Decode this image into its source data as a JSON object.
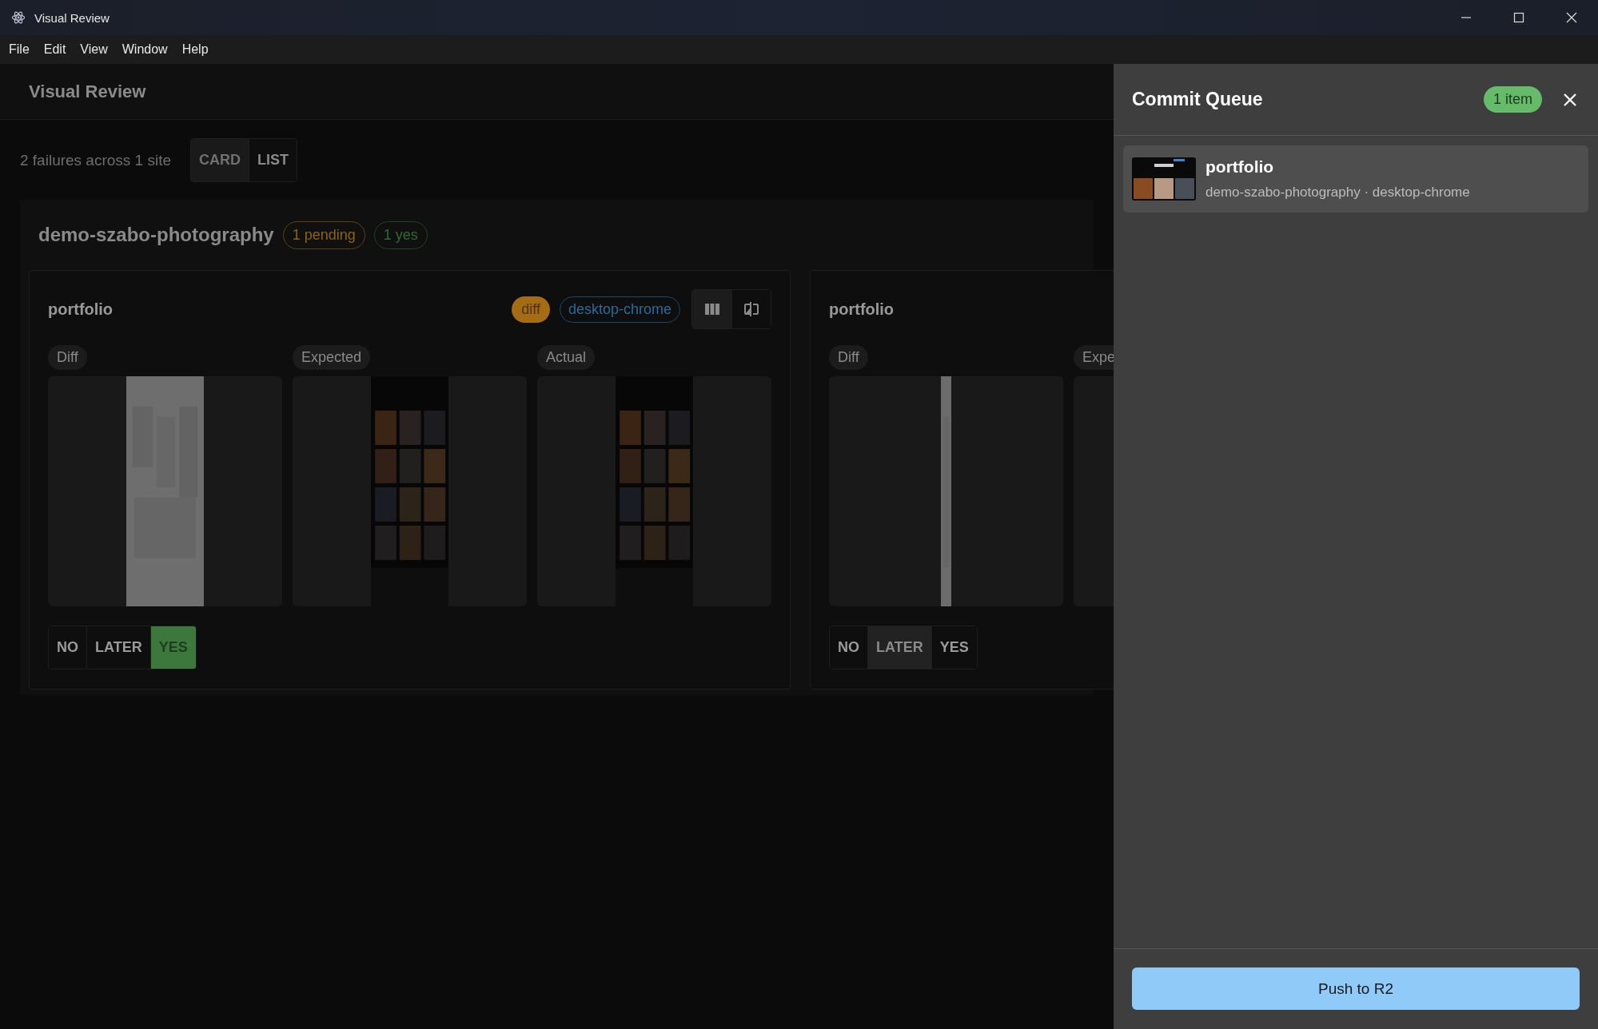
{
  "window": {
    "title": "Visual Review"
  },
  "menu": [
    "File",
    "Edit",
    "View",
    "Window",
    "Help"
  ],
  "header": {
    "title": "Visual Review"
  },
  "toolbar": {
    "summary": "2 failures across 1 site",
    "view_modes": [
      {
        "label": "CARD",
        "selected": true
      },
      {
        "label": "LIST",
        "selected": false
      }
    ]
  },
  "site": {
    "name": "demo-szabo-photography",
    "badges": [
      {
        "label": "1 pending",
        "kind": "pending"
      },
      {
        "label": "1 yes",
        "kind": "yes"
      }
    ]
  },
  "cards": [
    {
      "title": "portfolio",
      "status": "diff",
      "browser": "desktop-chrome",
      "layout_modes": [
        {
          "kind": "columns",
          "selected": true
        },
        {
          "kind": "compare",
          "selected": false
        }
      ],
      "panels": [
        {
          "label": "Diff",
          "kind": "diff-page"
        },
        {
          "label": "Expected",
          "kind": "screenshot"
        },
        {
          "label": "Actual",
          "kind": "screenshot"
        }
      ],
      "decisions": [
        {
          "label": "NO",
          "selected": false
        },
        {
          "label": "LATER",
          "selected": false
        },
        {
          "label": "YES",
          "selected": true
        }
      ]
    },
    {
      "title": "portfolio",
      "panels": [
        {
          "label": "Diff",
          "kind": "diff-strip"
        },
        {
          "label": "Expe",
          "kind": "empty"
        }
      ],
      "decisions": [
        {
          "label": "NO",
          "selected": false
        },
        {
          "label": "LATER",
          "selected": true
        },
        {
          "label": "YES",
          "selected": false
        }
      ]
    }
  ],
  "drawer": {
    "title": "Commit Queue",
    "count": "1 item",
    "items": [
      {
        "title": "portfolio",
        "subtitle": "demo-szabo-photography · desktop-chrome"
      }
    ],
    "action": "Push to R2"
  }
}
